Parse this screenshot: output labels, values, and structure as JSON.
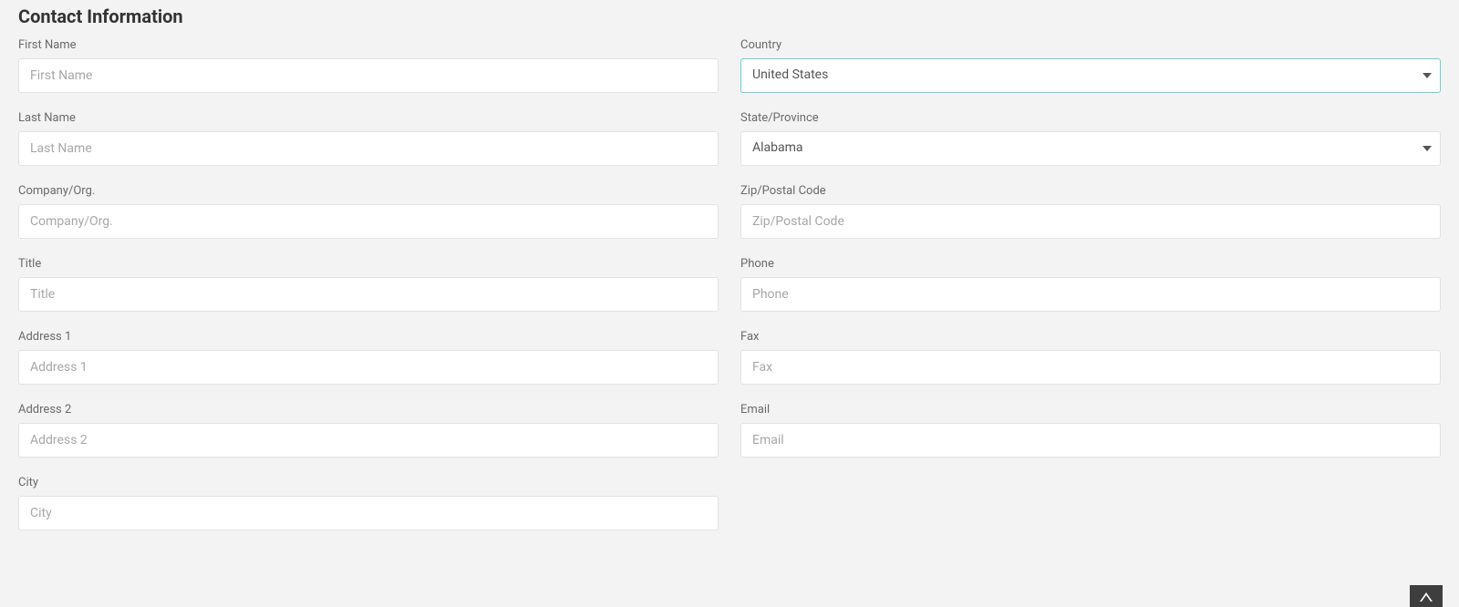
{
  "section_title": "Contact Information",
  "left_col": {
    "first_name": {
      "label": "First Name",
      "placeholder": "First Name",
      "value": ""
    },
    "last_name": {
      "label": "Last Name",
      "placeholder": "Last Name",
      "value": ""
    },
    "company": {
      "label": "Company/Org.",
      "placeholder": "Company/Org.",
      "value": ""
    },
    "title": {
      "label": "Title",
      "placeholder": "Title",
      "value": ""
    },
    "address1": {
      "label": "Address 1",
      "placeholder": "Address 1",
      "value": ""
    },
    "address2": {
      "label": "Address 2",
      "placeholder": "Address 2",
      "value": ""
    },
    "city": {
      "label": "City",
      "placeholder": "City",
      "value": ""
    }
  },
  "right_col": {
    "country": {
      "label": "Country",
      "value": "United States"
    },
    "state": {
      "label": "State/Province",
      "value": "Alabama"
    },
    "zip": {
      "label": "Zip/Postal Code",
      "placeholder": "Zip/Postal Code",
      "value": ""
    },
    "phone": {
      "label": "Phone",
      "placeholder": "Phone",
      "value": ""
    },
    "fax": {
      "label": "Fax",
      "placeholder": "Fax",
      "value": ""
    },
    "email": {
      "label": "Email",
      "placeholder": "Email",
      "value": ""
    }
  }
}
